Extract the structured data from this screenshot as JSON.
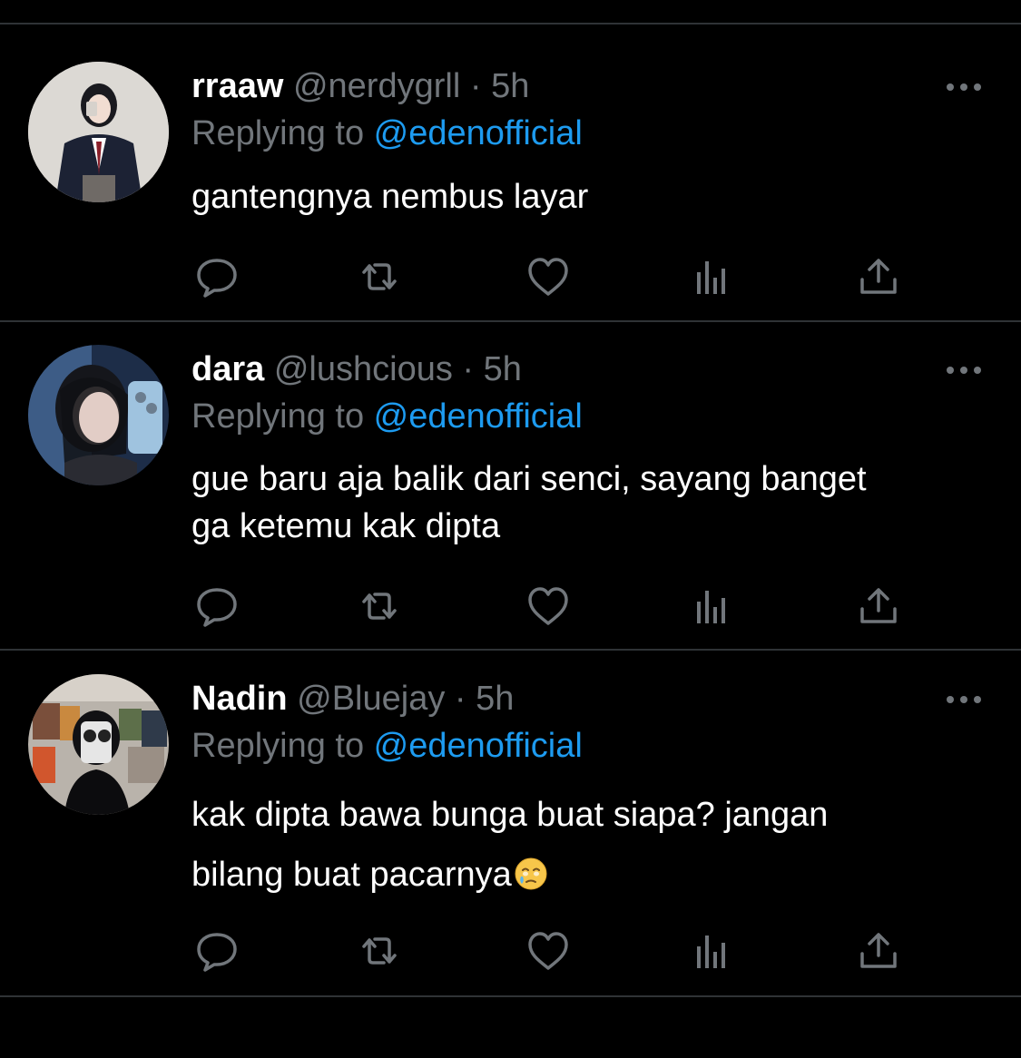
{
  "theme": {
    "background": "#000000",
    "divider": "#2f3336",
    "text_primary": "#ffffff",
    "text_secondary": "#71767b",
    "accent": "#1d9bf0"
  },
  "tweets": [
    {
      "display_name": "rraaw",
      "handle": "@nerdygrll",
      "separator": "·",
      "time": "5h",
      "replying_prefix": "Replying to ",
      "replying_to": "@edenofficial",
      "text": "gantengnya nembus layar",
      "emoji": "",
      "more_icon": "more-horizontal-icon",
      "actions": [
        "reply-icon",
        "retweet-icon",
        "like-icon",
        "views-icon",
        "share-icon"
      ]
    },
    {
      "display_name": "dara",
      "handle": "@lushcious",
      "separator": "·",
      "time": "5h",
      "replying_prefix": "Replying to ",
      "replying_to": "@edenofficial",
      "text": "gue baru aja balik dari senci, sayang banget\nga ketemu kak dipta",
      "emoji": "",
      "more_icon": "more-horizontal-icon",
      "actions": [
        "reply-icon",
        "retweet-icon",
        "like-icon",
        "views-icon",
        "share-icon"
      ]
    },
    {
      "display_name": "Nadin",
      "handle": "@Bluejay",
      "separator": "·",
      "time": "5h",
      "replying_prefix": "Replying to ",
      "replying_to": "@edenofficial",
      "text": "kak dipta bawa bunga buat siapa? jangan\nbilang buat pacarnya",
      "emoji": "face-holding-back-tears",
      "more_icon": "more-horizontal-icon",
      "actions": [
        "reply-icon",
        "retweet-icon",
        "like-icon",
        "views-icon",
        "share-icon"
      ]
    }
  ]
}
